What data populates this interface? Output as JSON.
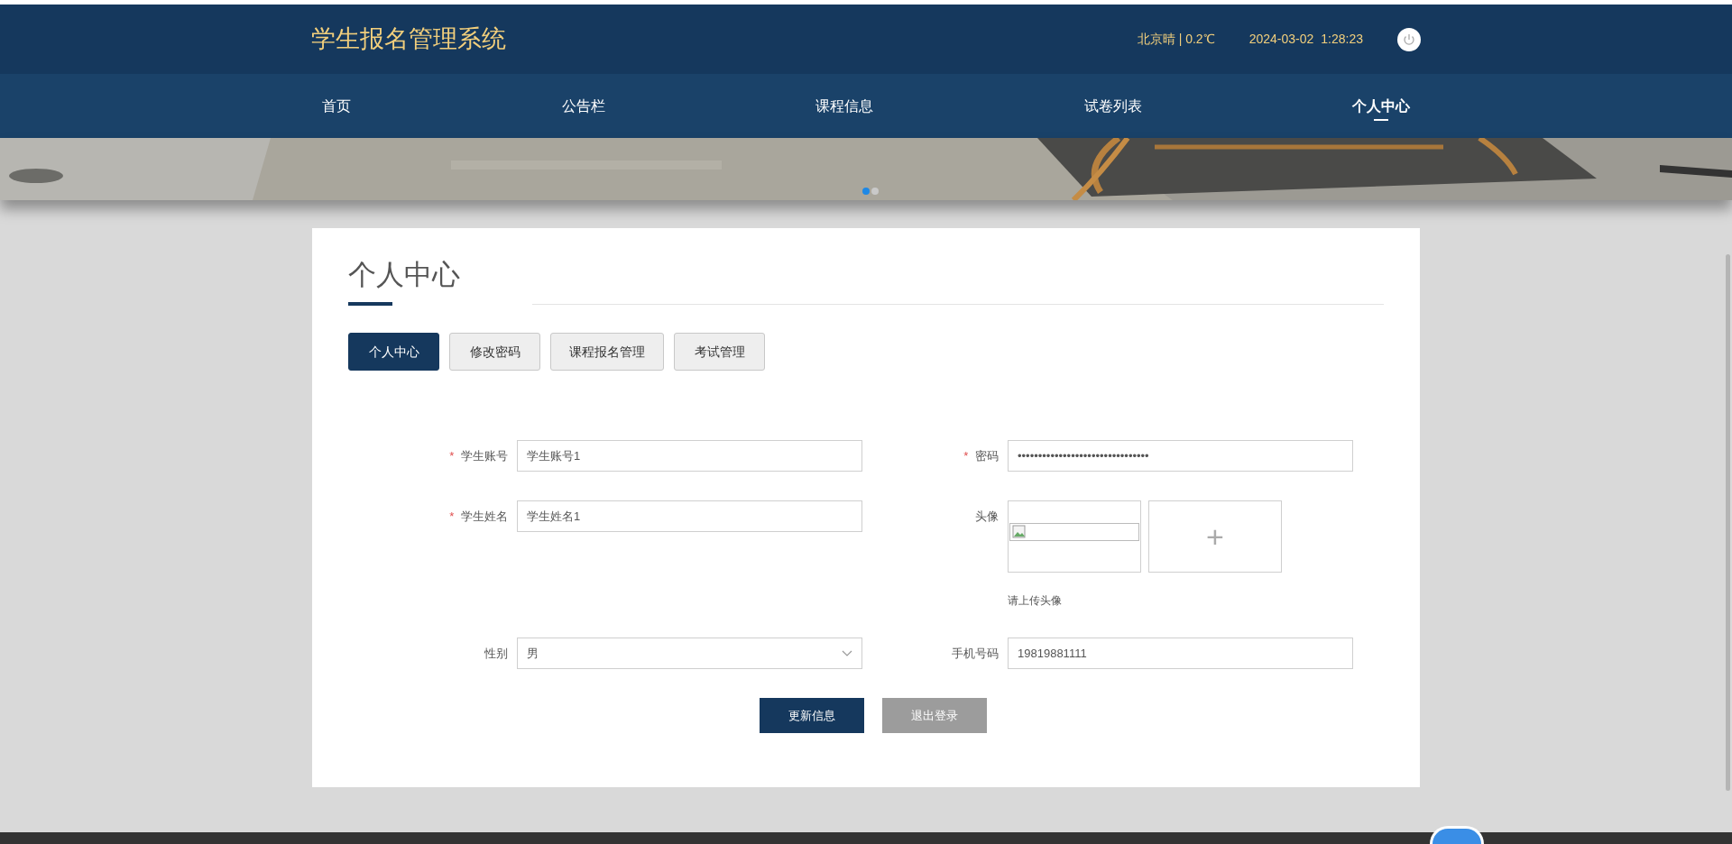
{
  "header": {
    "title": "学生报名管理系统",
    "weather": "北京晴 | 0.2℃",
    "date": "2024-03-02",
    "time": "1:28:23"
  },
  "nav": [
    {
      "label": "首页",
      "selected": false
    },
    {
      "label": "公告栏",
      "selected": false
    },
    {
      "label": "课程信息",
      "selected": false
    },
    {
      "label": "试卷列表",
      "selected": false
    },
    {
      "label": "个人中心",
      "selected": true
    }
  ],
  "banner": {
    "slides": [
      {
        "selected": true
      },
      {
        "selected": false
      }
    ]
  },
  "page_title": "个人中心",
  "tabs": [
    {
      "label": "个人中心",
      "selected": true
    },
    {
      "label": "修改密码",
      "selected": false
    },
    {
      "label": "课程报名管理",
      "selected": false
    },
    {
      "label": "考试管理",
      "selected": false
    }
  ],
  "form": {
    "required_mark": "*",
    "fields": [
      {
        "kind": "text",
        "label": "学生账号",
        "required": true,
        "value": "学生账号1"
      },
      {
        "kind": "password",
        "label": "密码",
        "required": true,
        "value": "••••••••••••••••••••••••••••••••"
      },
      {
        "kind": "text",
        "label": "学生姓名",
        "required": true,
        "value": "学生姓名1"
      },
      {
        "kind": "upload",
        "label": "头像",
        "required": false,
        "hint": "请上传头像",
        "add_symbol": "+"
      },
      {
        "kind": "select",
        "label": "性别",
        "required": false,
        "value": "男"
      },
      {
        "kind": "text",
        "label": "手机号码",
        "required": false,
        "value": "19819881111"
      }
    ],
    "buttons": [
      {
        "label": "更新信息",
        "kind": "primary"
      },
      {
        "label": "退出登录",
        "kind": "secondary"
      }
    ]
  }
}
